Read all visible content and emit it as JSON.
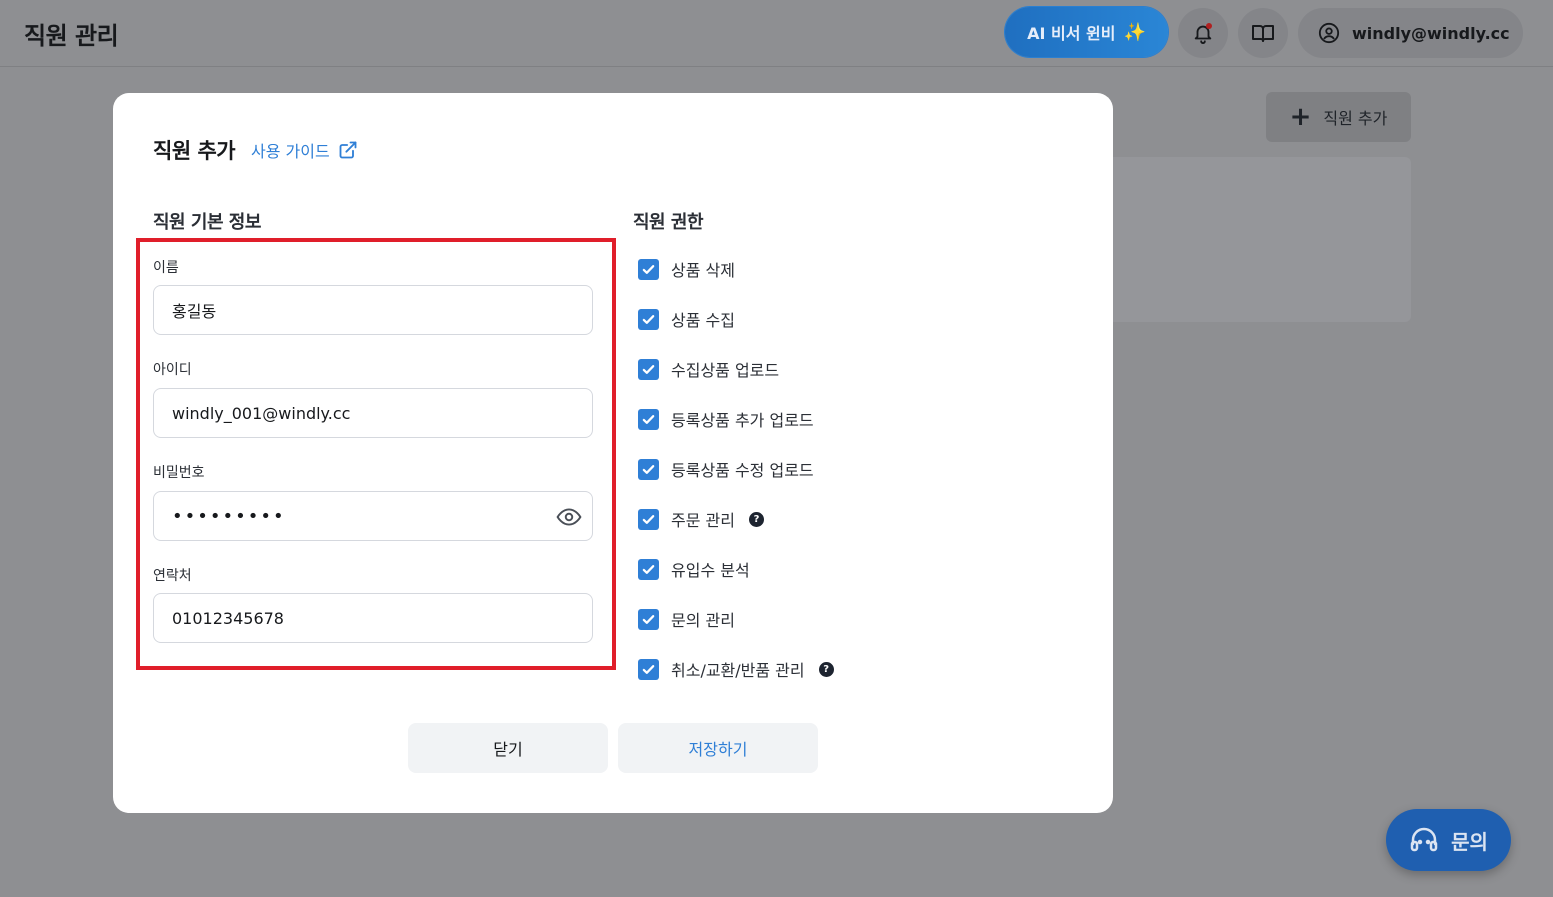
{
  "header": {
    "title": "직원 관리",
    "ai_button": "AI 비서 윈비",
    "account": "windly@windly.cc"
  },
  "background": {
    "add_employee_button": "직원 추가",
    "inquiry_button": "문의"
  },
  "modal": {
    "title": "직원 추가",
    "guide_link": "사용 가이드",
    "basic_info_title": "직원 기본 정보",
    "permissions_title": "직원 권한",
    "fields": {
      "name": {
        "label": "이름",
        "value": "홍길동"
      },
      "user_id": {
        "label": "아이디",
        "value": "windly_001@windly.cc"
      },
      "password": {
        "label": "비밀번호",
        "value": "•••••••••"
      },
      "phone": {
        "label": "연락처",
        "value": "01012345678"
      }
    },
    "permissions": [
      {
        "label": "상품 삭제",
        "checked": true,
        "help": false
      },
      {
        "label": "상품 수집",
        "checked": true,
        "help": false
      },
      {
        "label": "수집상품 업로드",
        "checked": true,
        "help": false
      },
      {
        "label": "등록상품 추가 업로드",
        "checked": true,
        "help": false
      },
      {
        "label": "등록상품 수정 업로드",
        "checked": true,
        "help": false
      },
      {
        "label": "주문 관리",
        "checked": true,
        "help": true
      },
      {
        "label": "유입수 분석",
        "checked": true,
        "help": false
      },
      {
        "label": "문의 관리",
        "checked": true,
        "help": false
      },
      {
        "label": "취소/교환/반품 관리",
        "checked": true,
        "help": true
      }
    ],
    "close_button": "닫기",
    "save_button": "저장하기"
  },
  "colors": {
    "accent": "#2f7fd6",
    "highlight_border": "#e01e2a",
    "overlay": "#8e8f92"
  }
}
